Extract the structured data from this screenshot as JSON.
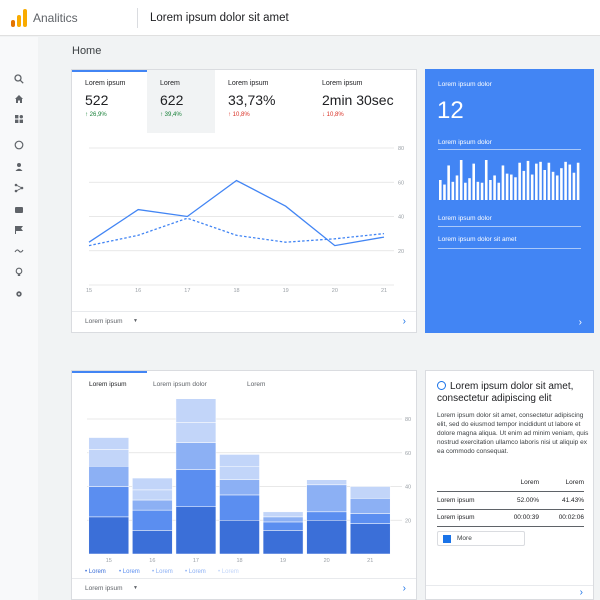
{
  "app": {
    "name": "Analitics",
    "account_title": "Lorem ipsum dolor sit amet"
  },
  "colors": {
    "accent": "#4285f4",
    "up": "#188038",
    "down": "#d93025"
  },
  "nav_icons": [
    "search-icon",
    "home-icon",
    "customization-icon",
    "realtime-icon",
    "audience-icon",
    "acquisition-icon",
    "behavior-icon",
    "conversions-icon",
    "attribution-icon",
    "discover-icon",
    "admin-icon"
  ],
  "page": {
    "title": "Home"
  },
  "overview": {
    "metrics": [
      {
        "label": "Lorem ipsum",
        "value": "522",
        "change": "↑ 26,9%",
        "direction": "up"
      },
      {
        "label": "Lorem",
        "value": "622",
        "change": "↑ 39,4%",
        "direction": "up"
      },
      {
        "label": "Lorem ipsum",
        "value": "33,73%",
        "change": "↑ 10,8%",
        "direction": "down"
      },
      {
        "label": "Lorem ipsum",
        "value": "2min 30sec",
        "change": "↓ 10,8%",
        "direction": "down"
      }
    ],
    "footer_label": "Lorem ipsum"
  },
  "chart_data": [
    {
      "type": "line",
      "x": [
        "15",
        "16",
        "17",
        "18",
        "19",
        "20",
        "21"
      ],
      "y_ticks": [
        "20",
        "40",
        "60",
        "80"
      ],
      "ylim": [
        0,
        80
      ],
      "grid": true,
      "series": [
        {
          "style": "solid",
          "values": [
            25,
            44,
            40,
            61,
            46,
            23,
            28
          ]
        },
        {
          "style": "dashed",
          "values": [
            23,
            29,
            39,
            29,
            25,
            27,
            30
          ]
        }
      ]
    },
    {
      "type": "bar",
      "stacked": true,
      "categories": [
        "15",
        "16",
        "17",
        "18",
        "19",
        "20",
        "21"
      ],
      "y_ticks": [
        "20",
        "40",
        "60",
        "80"
      ],
      "ylim": [
        0,
        80
      ],
      "grid": true,
      "colors": [
        "#3b6fd8",
        "#5b8ef0",
        "#8cb0f4",
        "#c2d5f9"
      ],
      "series": [
        {
          "name": "Lorem",
          "values": [
            22,
            14,
            28,
            20,
            14,
            20,
            18
          ]
        },
        {
          "name": "Lorem",
          "values": [
            18,
            12,
            22,
            15,
            5,
            5,
            6
          ]
        },
        {
          "name": "Lorem",
          "values": [
            12,
            6,
            16,
            9,
            3,
            16,
            9
          ]
        },
        {
          "name": "Lorem",
          "values": [
            10,
            6,
            12,
            8,
            3,
            3,
            7
          ]
        },
        {
          "name": "Lorem",
          "values": [
            7,
            7,
            14,
            7,
            0,
            0,
            0
          ]
        }
      ]
    },
    {
      "type": "bar",
      "values": [
        22,
        17,
        38,
        20,
        27,
        44,
        19,
        24,
        40,
        20,
        19,
        44,
        22,
        27,
        19,
        38,
        29,
        28,
        25,
        41,
        32,
        43,
        28,
        40,
        42,
        33,
        41,
        31,
        27,
        35,
        42,
        39,
        30,
        41
      ]
    }
  ],
  "realtime": {
    "label": "Lorem ipsum dolor",
    "value": "12",
    "sub_label": "Lorem ipsum dolor",
    "bottom_label_1": "Lorem ipsum dolor",
    "bottom_label_2": "Lorem ipsum dolor sit amet"
  },
  "acquisition": {
    "tabs": [
      "Lorem ipsum",
      "Lorem ipsum dolor",
      "Lorem"
    ],
    "legend": [
      "• Lorem",
      "• Lorem",
      "• Lorem",
      "• Lorem",
      "• Lorem"
    ],
    "footer_label": "Lorem ipsum"
  },
  "insight": {
    "title": "Lorem ipsum dolor sit amet, consectetur adipiscing elit",
    "body": "Lorem ipsum dolor sit amet, consectetur adipiscing elit, sed do eiusmod tempor incididunt ut labore et dolore magna aliqua. Ut enim ad minim veniam, quis nostrud exercitation ullamco laboris nisi ut aliquip ex ea commodo consequat.",
    "table": {
      "headers": [
        "",
        "Lorem",
        "Lorem"
      ],
      "rows": [
        [
          "Lorem ipsum",
          "52.00%",
          "41.43%"
        ],
        [
          "Lorem ipsum",
          "00:00:39",
          "00:02:06"
        ]
      ]
    },
    "more_label": "More"
  }
}
